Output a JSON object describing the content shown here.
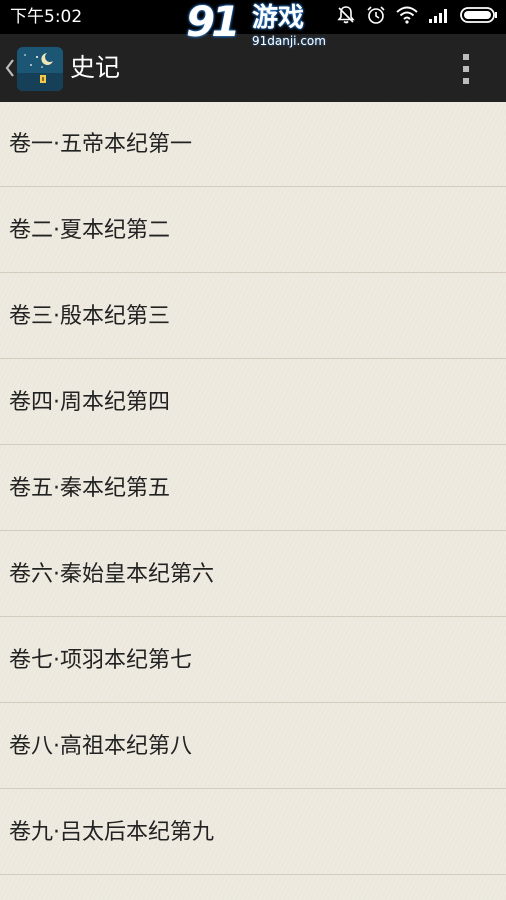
{
  "status_bar": {
    "time": "下午5:02",
    "icons": [
      "notification-off-icon",
      "alarm-icon",
      "wifi-icon",
      "signal-icon",
      "battery-icon"
    ]
  },
  "watermark": {
    "logo": "91",
    "brand": "游戏",
    "url": "91danji.com"
  },
  "action_bar": {
    "title": "史记",
    "back_icon": "chevron-left-icon",
    "menu_icon": "overflow-menu-icon"
  },
  "chapters": [
    {
      "label": "卷一·五帝本纪第一"
    },
    {
      "label": "卷二·夏本纪第二"
    },
    {
      "label": "卷三·殷本纪第三"
    },
    {
      "label": "卷四·周本纪第四"
    },
    {
      "label": "卷五·秦本纪第五"
    },
    {
      "label": "卷六·秦始皇本纪第六"
    },
    {
      "label": "卷七·项羽本纪第七"
    },
    {
      "label": "卷八·高祖本纪第八"
    },
    {
      "label": "卷九·吕太后本纪第九"
    },
    {
      "label": ""
    }
  ],
  "colors": {
    "status_bar_bg": "#000000",
    "action_bar_bg": "#222222",
    "list_bg": "#ece8dd",
    "divider": "#d3cdbf",
    "text": "#222222",
    "app_icon_bg": "#1e5a7a"
  }
}
